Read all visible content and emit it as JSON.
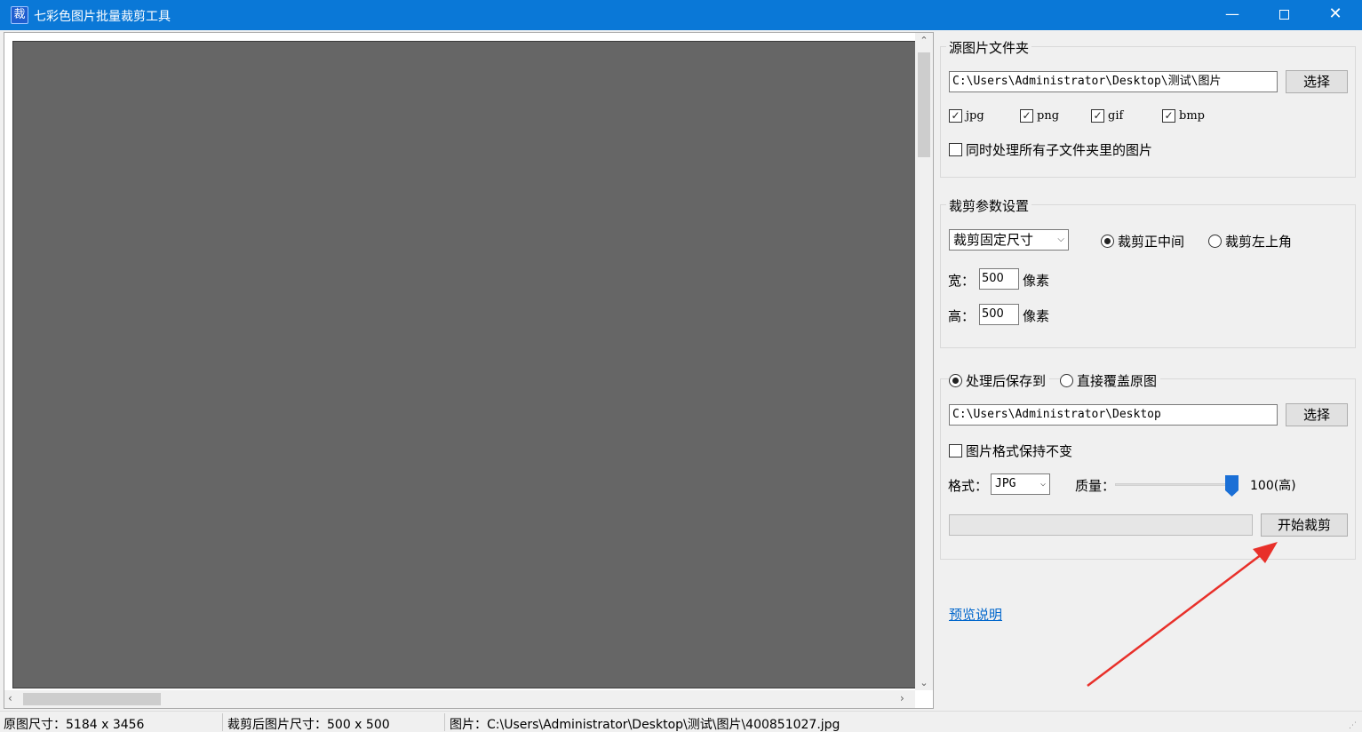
{
  "window": {
    "app_icon": "裁",
    "title": "七彩色图片批量裁剪工具",
    "minimize": "—",
    "close": "✕"
  },
  "source": {
    "group_title": "源图片文件夹",
    "path": "C:\\Users\\Administrator\\Desktop\\测试\\图片",
    "choose_label": "选择",
    "formats": [
      {
        "label": "jpg",
        "checked": true
      },
      {
        "label": "png",
        "checked": true
      },
      {
        "label": "gif",
        "checked": true
      },
      {
        "label": "bmp",
        "checked": true
      }
    ],
    "subfolders_label": "同时处理所有子文件夹里的图片",
    "subfolders_checked": false
  },
  "crop": {
    "group_title": "裁剪参数设置",
    "mode_value": "裁剪固定尺寸",
    "center_label": "裁剪正中间",
    "center_selected": true,
    "topleft_label": "裁剪左上角",
    "topleft_selected": false,
    "width_label": "宽：",
    "width_value": "500",
    "height_label": "高：",
    "height_value": "500",
    "unit": "像素"
  },
  "output": {
    "save_to_label": "处理后保存到",
    "save_to_selected": true,
    "overwrite_label": "直接覆盖原图",
    "overwrite_selected": false,
    "path": "C:\\Users\\Administrator\\Desktop",
    "choose_label": "选择",
    "keep_format_label": "图片格式保持不变",
    "keep_format_checked": false,
    "format_label": "格式：",
    "format_value": "JPG",
    "quality_label": "质量：",
    "quality_value": "100(高)",
    "quality_level": 1.0,
    "progress": 0,
    "start_label": "开始裁剪"
  },
  "help_link": "预览说明",
  "status": {
    "original_size": "原图尺寸：5184 x 3456",
    "cropped_size": "裁剪后图片尺寸：500 x 500",
    "image_path": "图片：C:\\Users\\Administrator\\Desktop\\测试\\图片\\400851027.jpg"
  },
  "colors": {
    "titlebar": "#0a78d7",
    "canvas": "#666666",
    "annotation_arrow": "#e8302a",
    "slider_thumb": "#1a6fd6"
  }
}
